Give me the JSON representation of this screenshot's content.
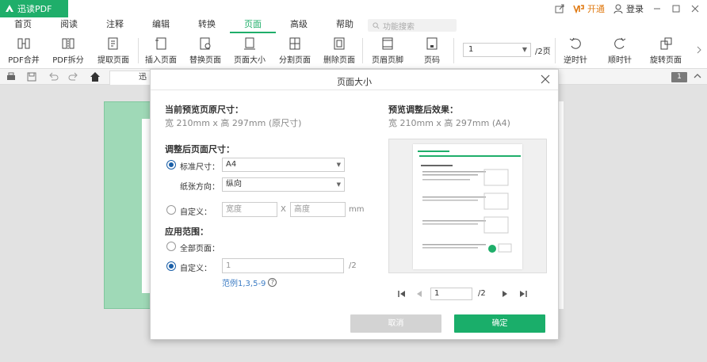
{
  "app": {
    "name": "迅读PDF",
    "open_label": "开通",
    "login_label": "登录"
  },
  "menu": {
    "tabs": [
      {
        "label": "首页"
      },
      {
        "label": "阅读"
      },
      {
        "label": "注释"
      },
      {
        "label": "编辑"
      },
      {
        "label": "转换"
      },
      {
        "label": "页面"
      },
      {
        "label": "高级"
      },
      {
        "label": "帮助"
      }
    ],
    "active_tab": "页面",
    "search_placeholder": "功能搜索"
  },
  "ribbon": {
    "buttons": [
      {
        "label": "PDF合并",
        "icon": "merge-icon"
      },
      {
        "label": "PDF拆分",
        "icon": "split-icon"
      },
      {
        "label": "提取页面",
        "icon": "extract-icon"
      },
      {
        "label": "插入页面",
        "icon": "insert-page-icon"
      },
      {
        "label": "替换页面",
        "icon": "replace-page-icon"
      },
      {
        "label": "页面大小",
        "icon": "page-size-icon"
      },
      {
        "label": "分割页面",
        "icon": "divide-page-icon"
      },
      {
        "label": "删除页面",
        "icon": "delete-page-icon"
      },
      {
        "label": "页眉页脚",
        "icon": "header-footer-icon"
      },
      {
        "label": "页码",
        "icon": "page-number-icon"
      },
      {
        "label": "逆时针",
        "icon": "rotate-ccw-icon"
      },
      {
        "label": "顺时针",
        "icon": "rotate-cw-icon"
      },
      {
        "label": "旋转页面",
        "icon": "rotate-page-icon"
      }
    ],
    "page_select_value": "1",
    "page_total": "/2页"
  },
  "quickbar": {
    "doc_tab_label": "迅",
    "page_badge": "1"
  },
  "dialog": {
    "title": "页面大小",
    "current_size_label": "当前预览页原尺寸：",
    "current_size_value": "宽 210mm x 高 297mm (原尺寸)",
    "preview_label": "预览调整后效果：",
    "preview_value": "宽 210mm x 高 297mm (A4)",
    "adjust_label": "调整后页面尺寸：",
    "standard_size_label": "标准尺寸：",
    "standard_size_value": "A4",
    "orientation_label": "纸张方向：",
    "orientation_value": "纵向",
    "custom_label": "自定义：",
    "width_placeholder": "宽度",
    "height_placeholder": "高度",
    "times_sign": "X",
    "unit": "mm",
    "range_label": "应用范围：",
    "all_pages_label": "全部页面：",
    "custom_range_label": "自定义：",
    "custom_range_value": "1",
    "custom_range_total": "/2",
    "range_example": "范例1,3,5-9",
    "help_glyph": "?",
    "pager_value": "1",
    "pager_total": "/2",
    "cancel_label": "取消",
    "ok_label": "确定"
  },
  "colors": {
    "brand_green": "#1fae6a",
    "accent_orange": "#e07a12",
    "radio_blue": "#1a5fa8",
    "link_blue": "#3c7cc4"
  }
}
